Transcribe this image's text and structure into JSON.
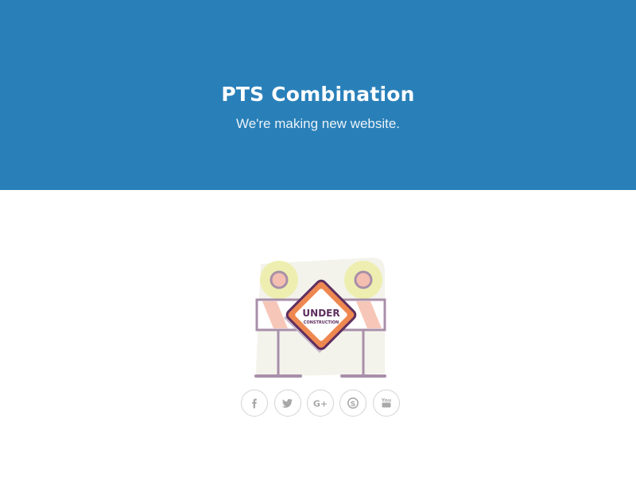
{
  "hero": {
    "title": "PTS Combination",
    "subtitle": "We're making new website.",
    "background_color": "#2980b9"
  },
  "illustration": {
    "sign_text_main": "UNDER",
    "sign_text_sub": "CONSTRUCTION",
    "colors": {
      "lamp_glow": "#eeeeb0",
      "lamp_bulb": "#f4bfb0",
      "frame": "#a88fa8",
      "sign_border": "#ee8850",
      "sign_text": "#5e2e5e",
      "backdrop": "#f3f3ec"
    }
  },
  "social": {
    "items": [
      {
        "name": "facebook",
        "icon": "facebook-icon",
        "glyph": "f"
      },
      {
        "name": "twitter",
        "icon": "twitter-icon",
        "glyph": ""
      },
      {
        "name": "google-plus",
        "icon": "google-plus-icon",
        "glyph": "G+"
      },
      {
        "name": "skype",
        "icon": "skype-icon",
        "glyph": "S"
      },
      {
        "name": "youtube",
        "icon": "youtube-icon",
        "glyph": "You"
      }
    ],
    "icon_color": "#a8a8a8",
    "border_color": "#d3d3d3"
  }
}
